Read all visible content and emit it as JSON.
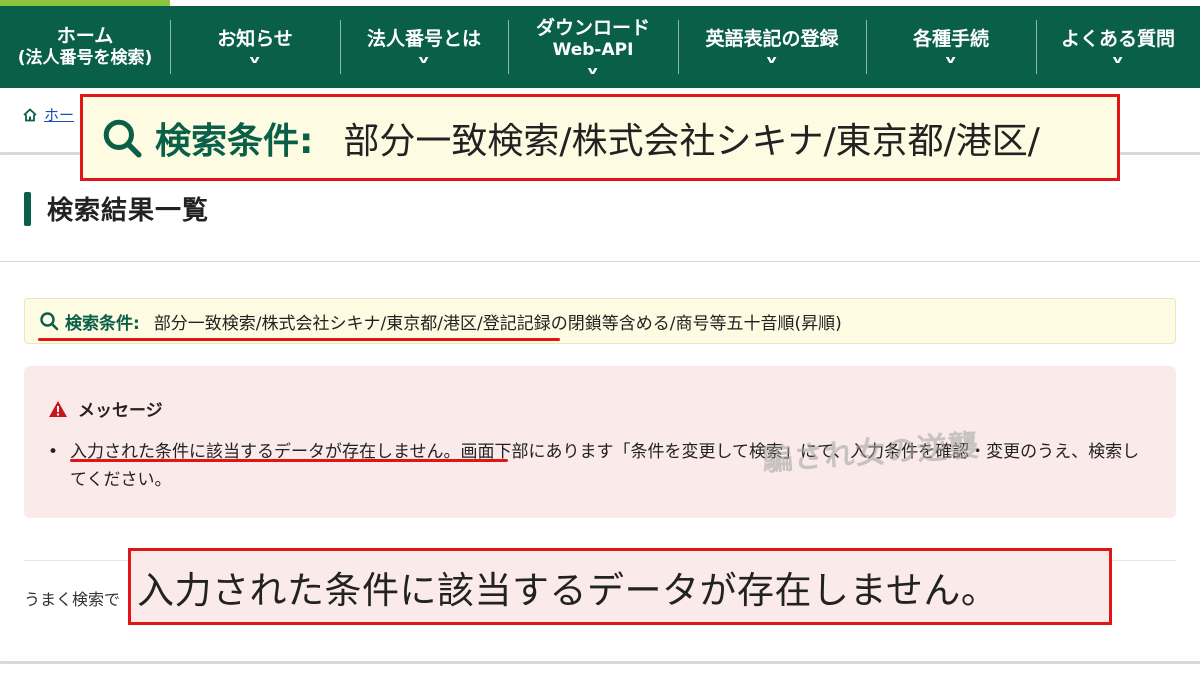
{
  "nav": {
    "items": [
      {
        "line1": "ホーム",
        "line2": "(法人番号を検索)",
        "chevron": false,
        "width": 170
      },
      {
        "line1": "お知らせ",
        "line2": "",
        "chevron": true,
        "width": 170
      },
      {
        "line1": "法人番号とは",
        "line2": "",
        "chevron": true,
        "width": 168
      },
      {
        "line1": "ダウンロード",
        "line2": "Web-API",
        "chevron": true,
        "width": 170
      },
      {
        "line1": "英語表記の登録",
        "line2": "",
        "chevron": true,
        "width": 188
      },
      {
        "line1": "各種手続",
        "line2": "",
        "chevron": true,
        "width": 170
      },
      {
        "line1": "よくある質問",
        "line2": "",
        "chevron": true,
        "width": 164
      }
    ],
    "chevron_glyph": "v"
  },
  "breadcrumb": {
    "home": "ホー"
  },
  "section": {
    "title": "検索結果一覧"
  },
  "condition": {
    "label": "検索条件:",
    "value": "部分一致検索/株式会社シキナ/東京都/港区/登記記録の閉鎖等含める/商号等五十音順(昇順)"
  },
  "message": {
    "heading": "メッセージ",
    "body": "入力された条件に該当するデータが存在しません。画面下部にあります「条件を変更して検索」にて、入力条件を確認・変更のうえ、検索してください。"
  },
  "hint": {
    "text": "うまく検索で"
  },
  "watermark": {
    "text": "騙され女の逆襲"
  },
  "zoom": {
    "condition_label": "検索条件:",
    "condition_value": "部分一致検索/株式会社シキナ/東京都/港区/",
    "message": "入力された条件に該当するデータが存在しません。"
  },
  "colors": {
    "nav_bg": "#0a5f48",
    "accent_green": "#8cc63f",
    "highlight_red": "#e01515",
    "condition_bg": "#fdfbe1",
    "message_bg": "#fbeaea"
  }
}
